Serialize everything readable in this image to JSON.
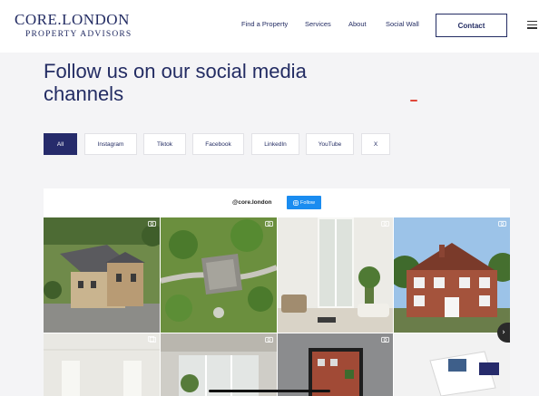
{
  "header": {
    "logo_main": "CORE.LONDON",
    "logo_sub": "PROPERTY ADVISORS",
    "nav": [
      "Find a Property",
      "Services",
      "About",
      "Social Wall"
    ],
    "contact_label": "Contact"
  },
  "page": {
    "title": "Follow us on our social media channels"
  },
  "filters": [
    "All",
    "Instagram",
    "Tiktok",
    "Facebook",
    "LinkedIn",
    "YouTube",
    "X"
  ],
  "active_filter": "All",
  "feed": {
    "handle": "@core.london",
    "follow_label": "Follow"
  },
  "tiles": [
    {
      "icon": "camera-icon",
      "subject": "aerial-house-photo"
    },
    {
      "icon": "camera-icon",
      "subject": "aerial-garden-photo"
    },
    {
      "icon": "camera-icon",
      "subject": "interior-living-room-photo"
    },
    {
      "icon": "camera-icon",
      "subject": "brick-house-photo"
    },
    {
      "icon": "gallery-icon",
      "subject": "empty-room-photo"
    },
    {
      "icon": "camera-icon",
      "subject": "bay-window-photo"
    },
    {
      "icon": "camera-icon",
      "subject": "framed-picture-photo"
    },
    {
      "icon": "camera-icon",
      "subject": "brochure-photo"
    }
  ],
  "colors": {
    "brand_navy": "#232c63",
    "follow_blue": "#1a8cf0",
    "accent_red": "#e0473a"
  }
}
